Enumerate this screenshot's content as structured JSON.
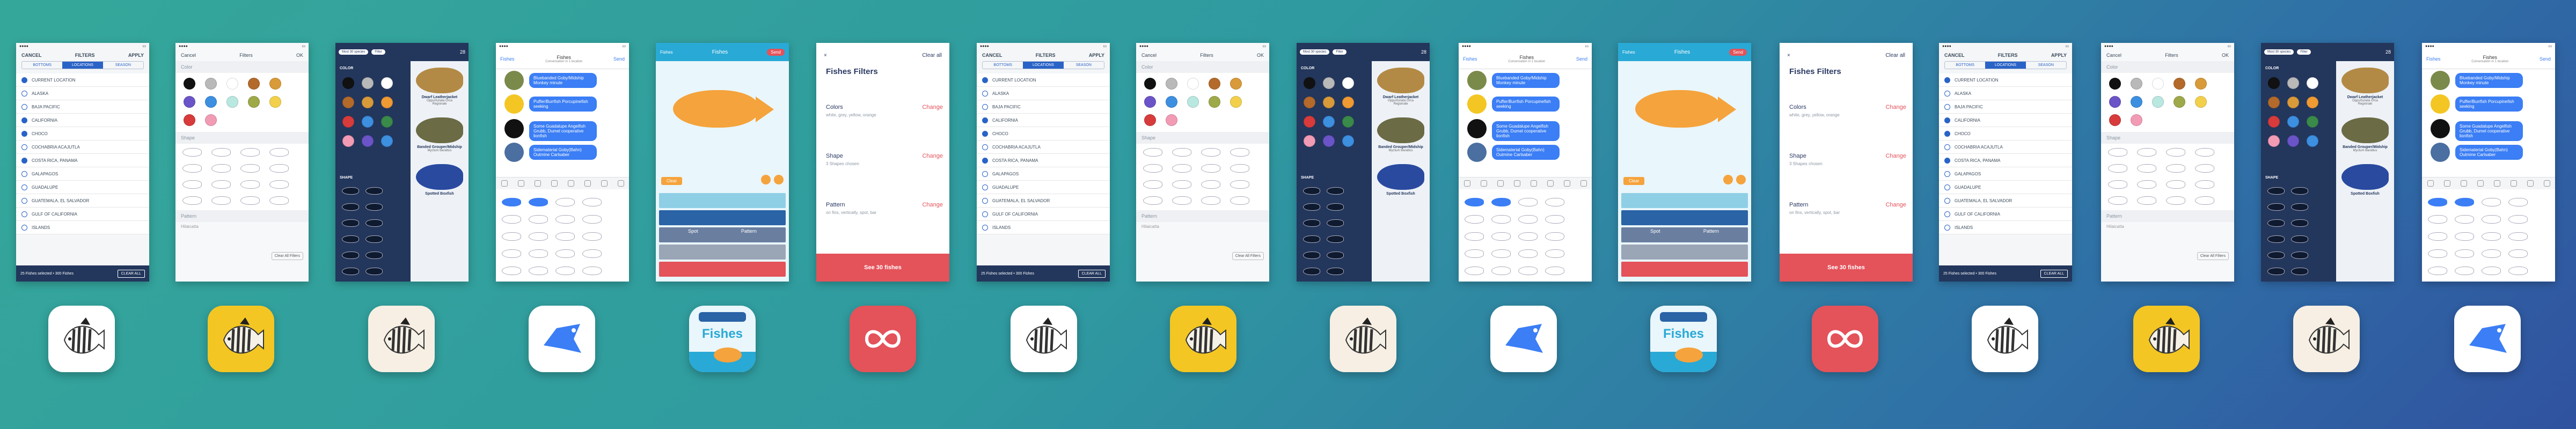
{
  "filters": {
    "buttons": {
      "cancel": "CANCEL",
      "filters": "FILTERS",
      "apply": "APPLY"
    },
    "segments": [
      "BOTTOMS",
      "LOCATIONS",
      "SEASON"
    ],
    "locations": [
      "CURRENT LOCATION",
      "ALASKA",
      "BAJA PACIFIC",
      "CALIFORNIA",
      "CHOCO",
      "COCHABRIA ACAJUTLA",
      "COSTA RICA, PANAMA",
      "GALAPAGOS",
      "GUADALUPE",
      "GUATEMALA, EL SALVADOR",
      "GULF OF CALIFORNIA",
      "ISLANDS"
    ],
    "checked": [
      true,
      false,
      false,
      true,
      true,
      false,
      true,
      false,
      false,
      false,
      false,
      false
    ],
    "footer_count": "25 Fishes selected • 300 Fishes",
    "footer_button": "CLEAR ALL"
  },
  "colorpicker": {
    "cancel": "Cancel",
    "title": "Filters",
    "ok": "OK",
    "color_label": "Color",
    "shape_label": "Shape",
    "pattern_label": "Pattern",
    "pattern_value": "Hilaicatta",
    "clear": "Clear All Filters",
    "colors": [
      "#111111",
      "#b9b9b9",
      "#ffffff",
      "#b46a2a",
      "#d99a3a",
      "#6a54c7",
      "#3d8fe0",
      "#b9e8e1",
      "#9ea94a",
      "#f2d04c",
      "#d83b3b",
      "#f29bb5"
    ]
  },
  "navypicker": {
    "pills": [
      "Most 30 species",
      "Filter"
    ],
    "count": "28",
    "color_label": "COLOR",
    "shape_label": "SHAPE",
    "colors": [
      "#111111",
      "#b9b9b9",
      "#ffffff",
      "#b46a2a",
      "#d99a3a",
      "#ef9a33",
      "#d83b3b",
      "#3d8fe0",
      "#3a8a4a",
      "#f29bb5",
      "#6a54c7",
      "#3d8fe0"
    ],
    "species": [
      {
        "name": "Dwarf Leatherjacket",
        "sub": "Oppurtunata Orca",
        "loc": "Regionale"
      },
      {
        "name": "Banded Grouper/Midship",
        "sub": "Myctum Barattus",
        "loc": ""
      },
      {
        "name": "Spotted Boxfish",
        "sub": "",
        "loc": ""
      }
    ]
  },
  "chat": {
    "back": "Fishes",
    "title": "Fishes",
    "subtitle": "Conversation in 1 location",
    "send": "Send",
    "bubbles": [
      "Bluebanded Goby/Midship Monkey minute",
      "Puffer/Burrfish Porcupinefish seeking",
      "Some Guadalupe Angelfish Grubb, Dumel cooperative lionfish",
      "Sidematerial Goby(Bahn) Outmine Carlsaber"
    ]
  },
  "builder": {
    "title": "Fishes",
    "back": "Fishes",
    "send": "Send",
    "clear": "Clear",
    "pattern_labels": [
      "Spot",
      "Pattern"
    ]
  },
  "filtersummary": {
    "close": "×",
    "clear_all": "Clear all",
    "title": "Fishes Filters",
    "groups": [
      {
        "label": "Colors",
        "value": "white, grey, yellow, orange",
        "change": "Change"
      },
      {
        "label": "Shape",
        "value": "3 Shapes chosen",
        "change": "Change"
      },
      {
        "label": "Pattern",
        "value": "on fins, vertically, spot, bar",
        "change": "Change"
      }
    ],
    "see_button": "See 30 fishes"
  },
  "icons": {
    "butterfly_label": "butterflyfish",
    "fishes_label": "Fishes"
  },
  "colors": {
    "accent_blue": "#3b7ef5",
    "navy": "#23365c",
    "red": "#e4525a",
    "yellow": "#f3c623",
    "cyan": "#29a9d6"
  }
}
